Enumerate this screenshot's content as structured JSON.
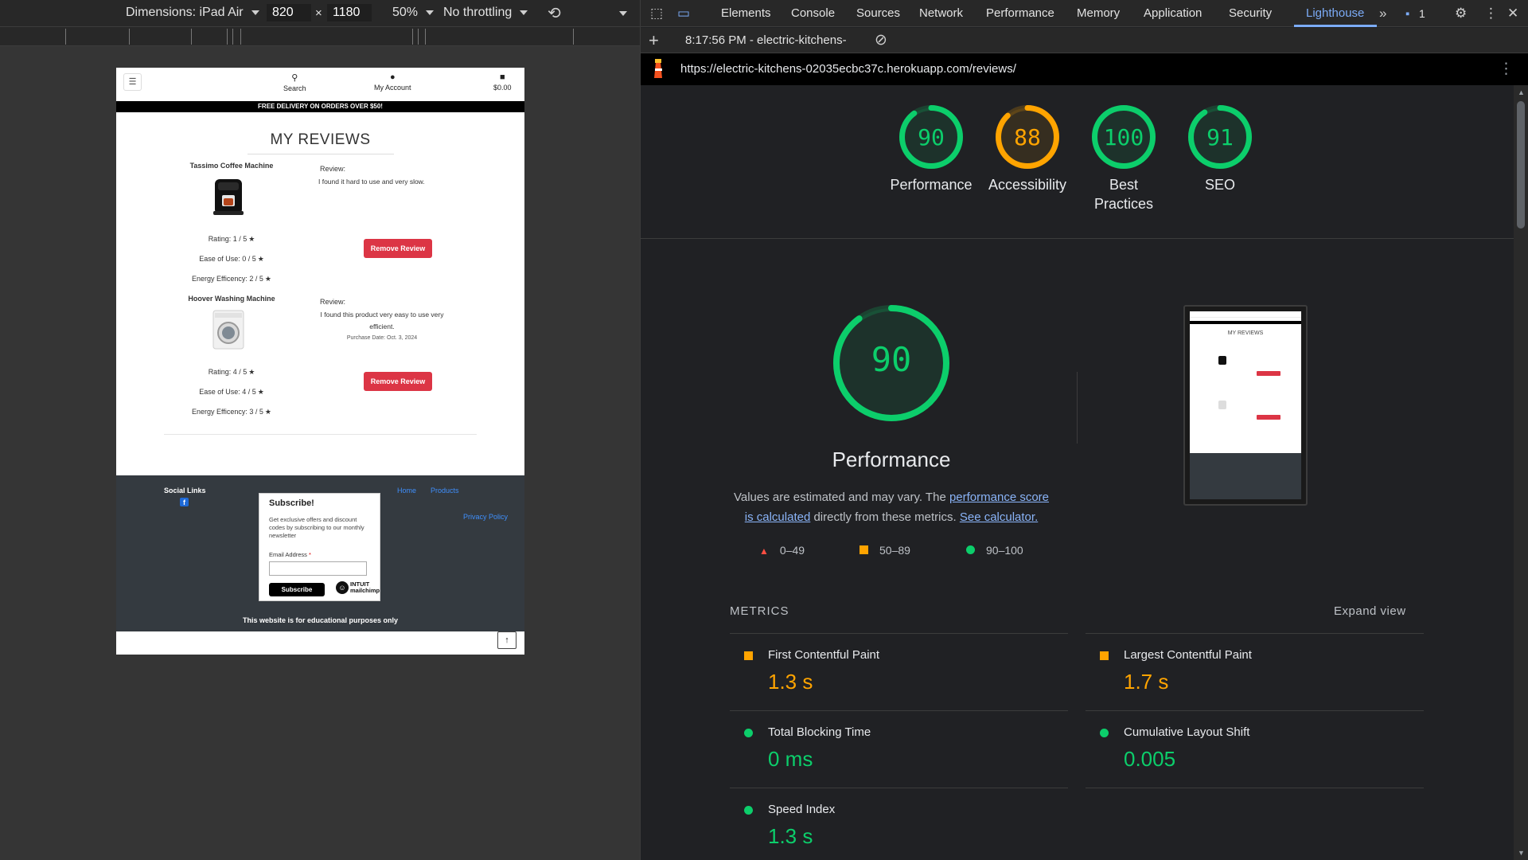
{
  "device_toolbar": {
    "dimensions_label": "Dimensions: iPad Air",
    "width": "820",
    "height": "1180",
    "times": "×",
    "zoom": "50%",
    "throttling": "No throttling"
  },
  "site": {
    "header": {
      "search": "Search",
      "account": "My Account",
      "cart": "$0.00"
    },
    "banner": "FREE DELIVERY ON ORDERS OVER $50!",
    "title": "MY REVIEWS",
    "reviews": [
      {
        "product": "Tassimo Coffee Machine",
        "rating": "Rating: 1 / 5",
        "ease": "Ease of Use: 0 / 5",
        "energy": "Energy Efficency: 2 / 5",
        "review_label": "Review:",
        "review_text": "I found it hard to use and very slow.",
        "purchase_date": "",
        "remove": "Remove Review"
      },
      {
        "product": "Hoover Washing Machine",
        "rating": "Rating: 4 / 5",
        "ease": "Ease of Use: 4 / 5",
        "energy": "Energy Efficency: 3 / 5",
        "review_label": "Review:",
        "review_text": "I found this product very easy to use very efficient.",
        "purchase_date": "Purchase Date: Oct. 3, 2024",
        "remove": "Remove Review"
      }
    ],
    "footer": {
      "social_title": "Social Links",
      "home": "Home",
      "products": "Products",
      "privacy": "Privacy Policy",
      "subscribe_title": "Subscribe!",
      "subscribe_desc": "Get exclusive offers and discount codes by subscribing to our monthly newsletter",
      "email_label": "Email Address",
      "required_mark": "*",
      "subscribe_button": "Subscribe",
      "mailchimp_line1": "INTUIT",
      "mailchimp_line2": "mailchimp",
      "edu_note": "This website is for educational purposes only"
    }
  },
  "devtools": {
    "tabs": [
      "Elements",
      "Console",
      "Sources",
      "Network",
      "Performance",
      "Memory",
      "Application",
      "Security",
      "Lighthouse"
    ],
    "active_tab": "Lighthouse",
    "issues_count": "1",
    "report_time": "8:17:56 PM - electric-kitchens-",
    "url": "https://electric-kitchens-02035ecbc37c.herokuapp.com/reviews/"
  },
  "lighthouse": {
    "scores": [
      {
        "value": "90",
        "label": "Performance",
        "score": 90,
        "color": "#0cce6b"
      },
      {
        "value": "88",
        "label": "Accessibility",
        "score": 88,
        "color": "#ffa400"
      },
      {
        "value": "100",
        "label": "Best Practices",
        "score": 100,
        "color": "#0cce6b"
      },
      {
        "value": "91",
        "label": "SEO",
        "score": 91,
        "color": "#0cce6b"
      }
    ],
    "main_score": {
      "value": "90",
      "label": "Performance",
      "score": 90,
      "color": "#0cce6b"
    },
    "desc_prefix": "Values are estimated and may vary. The ",
    "desc_link1": "performance score is calculated",
    "desc_middle": " directly from these metrics. ",
    "desc_link2": "See calculator.",
    "legend": [
      "0–49",
      "50–89",
      "90–100"
    ],
    "legend_colors": [
      "#ff4e42",
      "#ffa400",
      "#0cce6b"
    ],
    "metrics_label": "METRICS",
    "expand": "Expand view",
    "metrics": [
      {
        "name": "First Contentful Paint",
        "value": "1.3 s",
        "status": "orange"
      },
      {
        "name": "Largest Contentful Paint",
        "value": "1.7 s",
        "status": "orange"
      },
      {
        "name": "Total Blocking Time",
        "value": "0 ms",
        "status": "green"
      },
      {
        "name": "Cumulative Layout Shift",
        "value": "0.005",
        "status": "green"
      },
      {
        "name": "Speed Index",
        "value": "1.3 s",
        "status": "green"
      }
    ],
    "thumbnail": {
      "title": "MY REVIEWS",
      "remove": "Remove Review"
    }
  }
}
